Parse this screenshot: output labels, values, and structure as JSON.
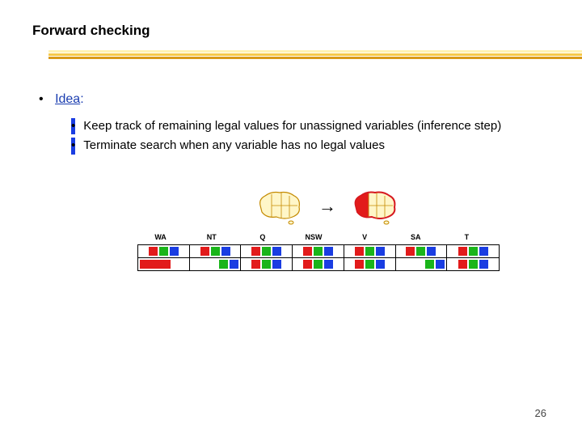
{
  "title": "Forward checking",
  "idea": {
    "label": "Idea",
    "colon": ":"
  },
  "bullets": [
    "Keep track of remaining legal values for unassigned variables (inference step)",
    "Terminate search when any variable has no legal values"
  ],
  "regions": [
    "WA",
    "NT",
    "Q",
    "NSW",
    "V",
    "SA",
    "T"
  ],
  "grid": {
    "row1": [
      [
        "r",
        "g",
        "b"
      ],
      [
        "r",
        "g",
        "b"
      ],
      [
        "r",
        "g",
        "b"
      ],
      [
        "r",
        "g",
        "b"
      ],
      [
        "r",
        "g",
        "b"
      ],
      [
        "r",
        "g",
        "b"
      ],
      [
        "r",
        "g",
        "b"
      ]
    ],
    "row2": [
      [
        "R"
      ],
      [
        "g",
        "b"
      ],
      [
        "r",
        "g",
        "b"
      ],
      [
        "r",
        "g",
        "b"
      ],
      [
        "r",
        "g",
        "b"
      ],
      [
        "g",
        "b"
      ],
      [
        "r",
        "g",
        "b"
      ]
    ]
  },
  "page_number": "26",
  "colors": {
    "red": "#e21b1b",
    "green": "#1ab51a",
    "blue": "#1a3de2",
    "link": "#1a3db0"
  }
}
